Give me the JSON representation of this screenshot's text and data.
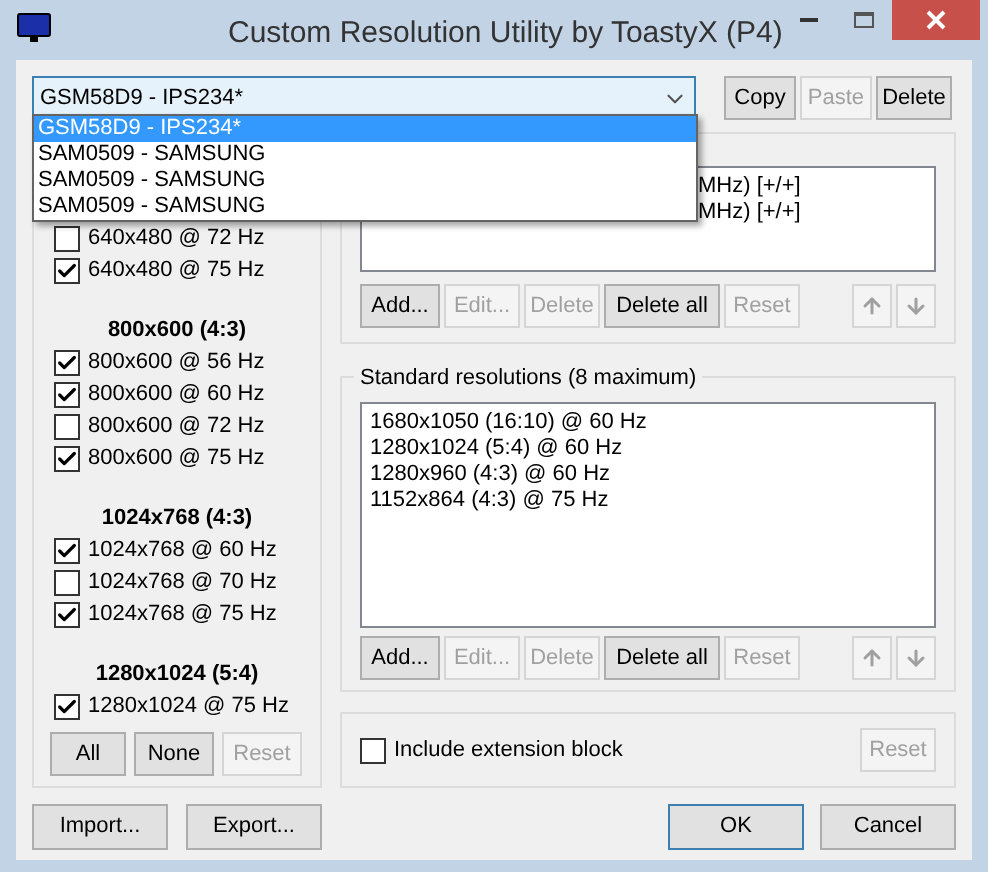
{
  "window": {
    "title": "Custom Resolution Utility by ToastyX (P4)"
  },
  "monitor": {
    "value": "GSM58D9 - IPS234*",
    "expanded": true,
    "options": [
      {
        "label": "GSM58D9 - IPS234*",
        "selected": true
      },
      {
        "label": "SAM0509 - SAMSUNG",
        "selected": false
      },
      {
        "label": "SAM0509 - SAMSUNG",
        "selected": false
      },
      {
        "label": "SAM0509 - SAMSUNG",
        "selected": false
      }
    ]
  },
  "monitor_buttons": [
    {
      "label": "Copy",
      "disabled": false
    },
    {
      "label": "Paste",
      "disabled": true
    },
    {
      "label": "Delete",
      "disabled": false
    }
  ],
  "established": {
    "groups": [
      {
        "items": [
          {
            "label": "640x480 @ 72 Hz",
            "checked": false
          },
          {
            "label": "640x480 @ 75 Hz",
            "checked": true
          }
        ]
      },
      {
        "title": "800x600 (4:3)",
        "items": [
          {
            "label": "800x600 @ 56 Hz",
            "checked": true
          },
          {
            "label": "800x600 @ 60 Hz",
            "checked": true
          },
          {
            "label": "800x600 @ 72 Hz",
            "checked": false
          },
          {
            "label": "800x600 @ 75 Hz",
            "checked": true
          }
        ]
      },
      {
        "title": "1024x768 (4:3)",
        "items": [
          {
            "label": "1024x768 @ 60 Hz",
            "checked": true
          },
          {
            "label": "1024x768 @ 70 Hz",
            "checked": false
          },
          {
            "label": "1024x768 @ 75 Hz",
            "checked": true
          }
        ]
      },
      {
        "title": "1280x1024 (5:4)",
        "items": [
          {
            "label": "1280x1024 @ 75 Hz",
            "checked": true
          }
        ]
      }
    ],
    "buttons": [
      {
        "label": "All",
        "disabled": false
      },
      {
        "label": "None",
        "disabled": false
      },
      {
        "label": "Reset",
        "disabled": true
      }
    ]
  },
  "detailed": {
    "items": [
      "MHz) [+/+]",
      "MHz) [+/+]"
    ],
    "buttons": [
      {
        "label": "Add...",
        "disabled": false
      },
      {
        "label": "Edit...",
        "disabled": true
      },
      {
        "label": "Delete",
        "disabled": true
      },
      {
        "label": "Delete all",
        "disabled": false
      },
      {
        "label": "Reset",
        "disabled": true
      }
    ],
    "arrows": [
      {
        "kind": "up",
        "disabled": true
      },
      {
        "kind": "down",
        "disabled": true
      }
    ]
  },
  "standard": {
    "title": "Standard resolutions (8 maximum)",
    "items": [
      "1680x1050 (16:10) @ 60 Hz",
      "1280x1024 (5:4) @ 60 Hz",
      "1280x960 (4:3) @ 60 Hz",
      "1152x864 (4:3) @ 75 Hz"
    ],
    "buttons": [
      {
        "label": "Add...",
        "disabled": false
      },
      {
        "label": "Edit...",
        "disabled": true
      },
      {
        "label": "Delete",
        "disabled": true
      },
      {
        "label": "Delete all",
        "disabled": false
      },
      {
        "label": "Reset",
        "disabled": true
      }
    ],
    "arrows": [
      {
        "kind": "up",
        "disabled": true
      },
      {
        "kind": "down",
        "disabled": true
      }
    ]
  },
  "extension": {
    "label": "Include extension block",
    "checked": false,
    "reset": {
      "label": "Reset",
      "disabled": true
    }
  },
  "footer": [
    {
      "label": "Import...",
      "default": false
    },
    {
      "label": "Export...",
      "default": false
    },
    {
      "label": "OK",
      "default": true
    },
    {
      "label": "Cancel",
      "default": false
    }
  ]
}
